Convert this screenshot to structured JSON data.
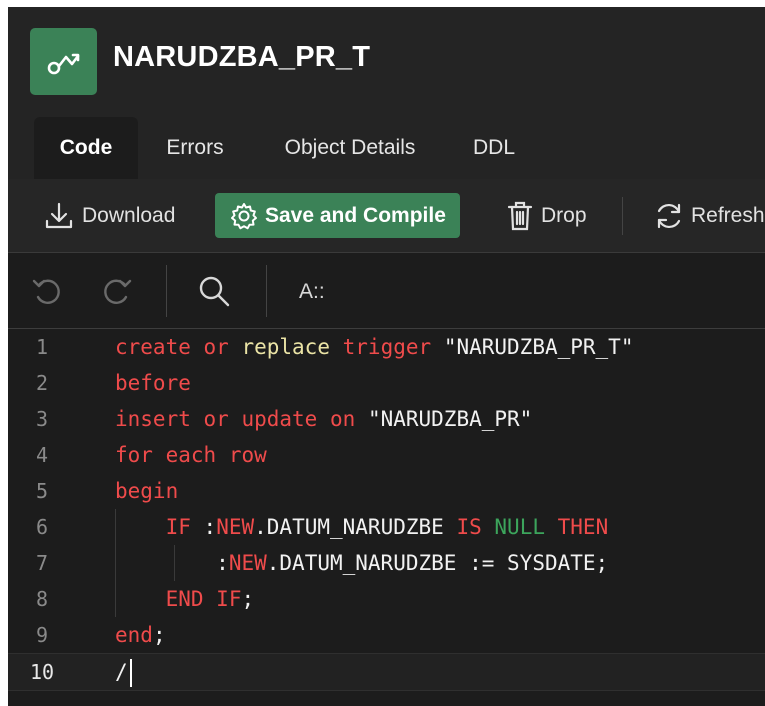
{
  "header": {
    "title": "NARUDZBA_PR_T",
    "logo_icon": "trigger-icon"
  },
  "tabs": [
    {
      "label": "Code",
      "active": true
    },
    {
      "label": "Errors",
      "active": false
    },
    {
      "label": "Object Details",
      "active": false
    },
    {
      "label": "DDL",
      "active": false
    }
  ],
  "toolbar": {
    "download_label": "Download",
    "save_compile_label": "Save and Compile",
    "drop_label": "Drop",
    "refresh_label": "Refresh"
  },
  "editor_toolbar": {
    "undo_icon": "undo-icon",
    "redo_icon": "redo-icon",
    "search_icon": "search-icon",
    "font_menu_label": "A::"
  },
  "code": {
    "current_line": 10,
    "lines": [
      {
        "n": "1",
        "t": "create or replace trigger \"NARUDZBA_PR_T\""
      },
      {
        "n": "2",
        "t": "before"
      },
      {
        "n": "3",
        "t": "insert or update on \"NARUDZBA_PR\""
      },
      {
        "n": "4",
        "t": "for each row"
      },
      {
        "n": "5",
        "t": "begin"
      },
      {
        "n": "6",
        "t": "    IF :NEW.DATUM_NARUDZBE IS NULL THEN"
      },
      {
        "n": "7",
        "t": "        :NEW.DATUM_NARUDZBE := SYSDATE;"
      },
      {
        "n": "8",
        "t": "    END IF;"
      },
      {
        "n": "9",
        "t": "end;"
      },
      {
        "n": "10",
        "t": "/"
      }
    ]
  },
  "colors": {
    "accent_green": "#3b8257",
    "keyword_red": "#ef4b4b",
    "identifier_yellow": "#ebe4a6",
    "null_green": "#3ca55c",
    "background": "#1c1c1c"
  }
}
